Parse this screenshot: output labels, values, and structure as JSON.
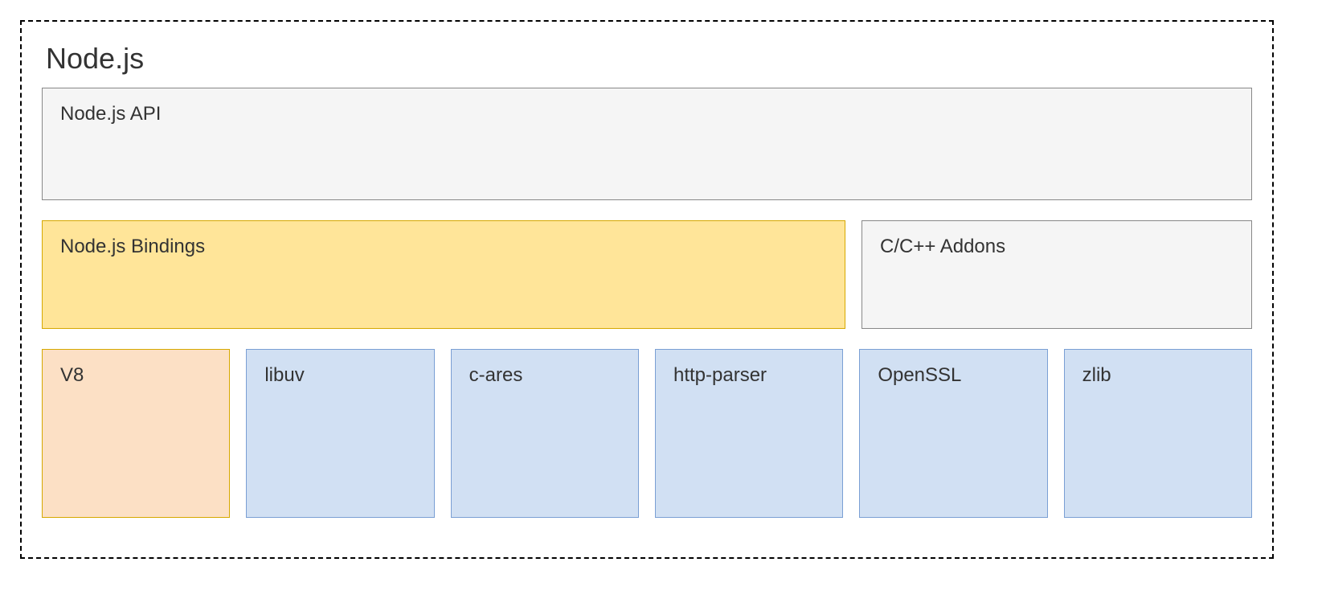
{
  "title": "Node.js",
  "row1": {
    "api": "Node.js API"
  },
  "row2": {
    "bindings": "Node.js Bindings",
    "addons": "C/C++ Addons"
  },
  "row3": {
    "v8": "V8",
    "libuv": "libuv",
    "cares": "c-ares",
    "httpparser": "http-parser",
    "openssl": "OpenSSL",
    "zlib": "zlib"
  }
}
